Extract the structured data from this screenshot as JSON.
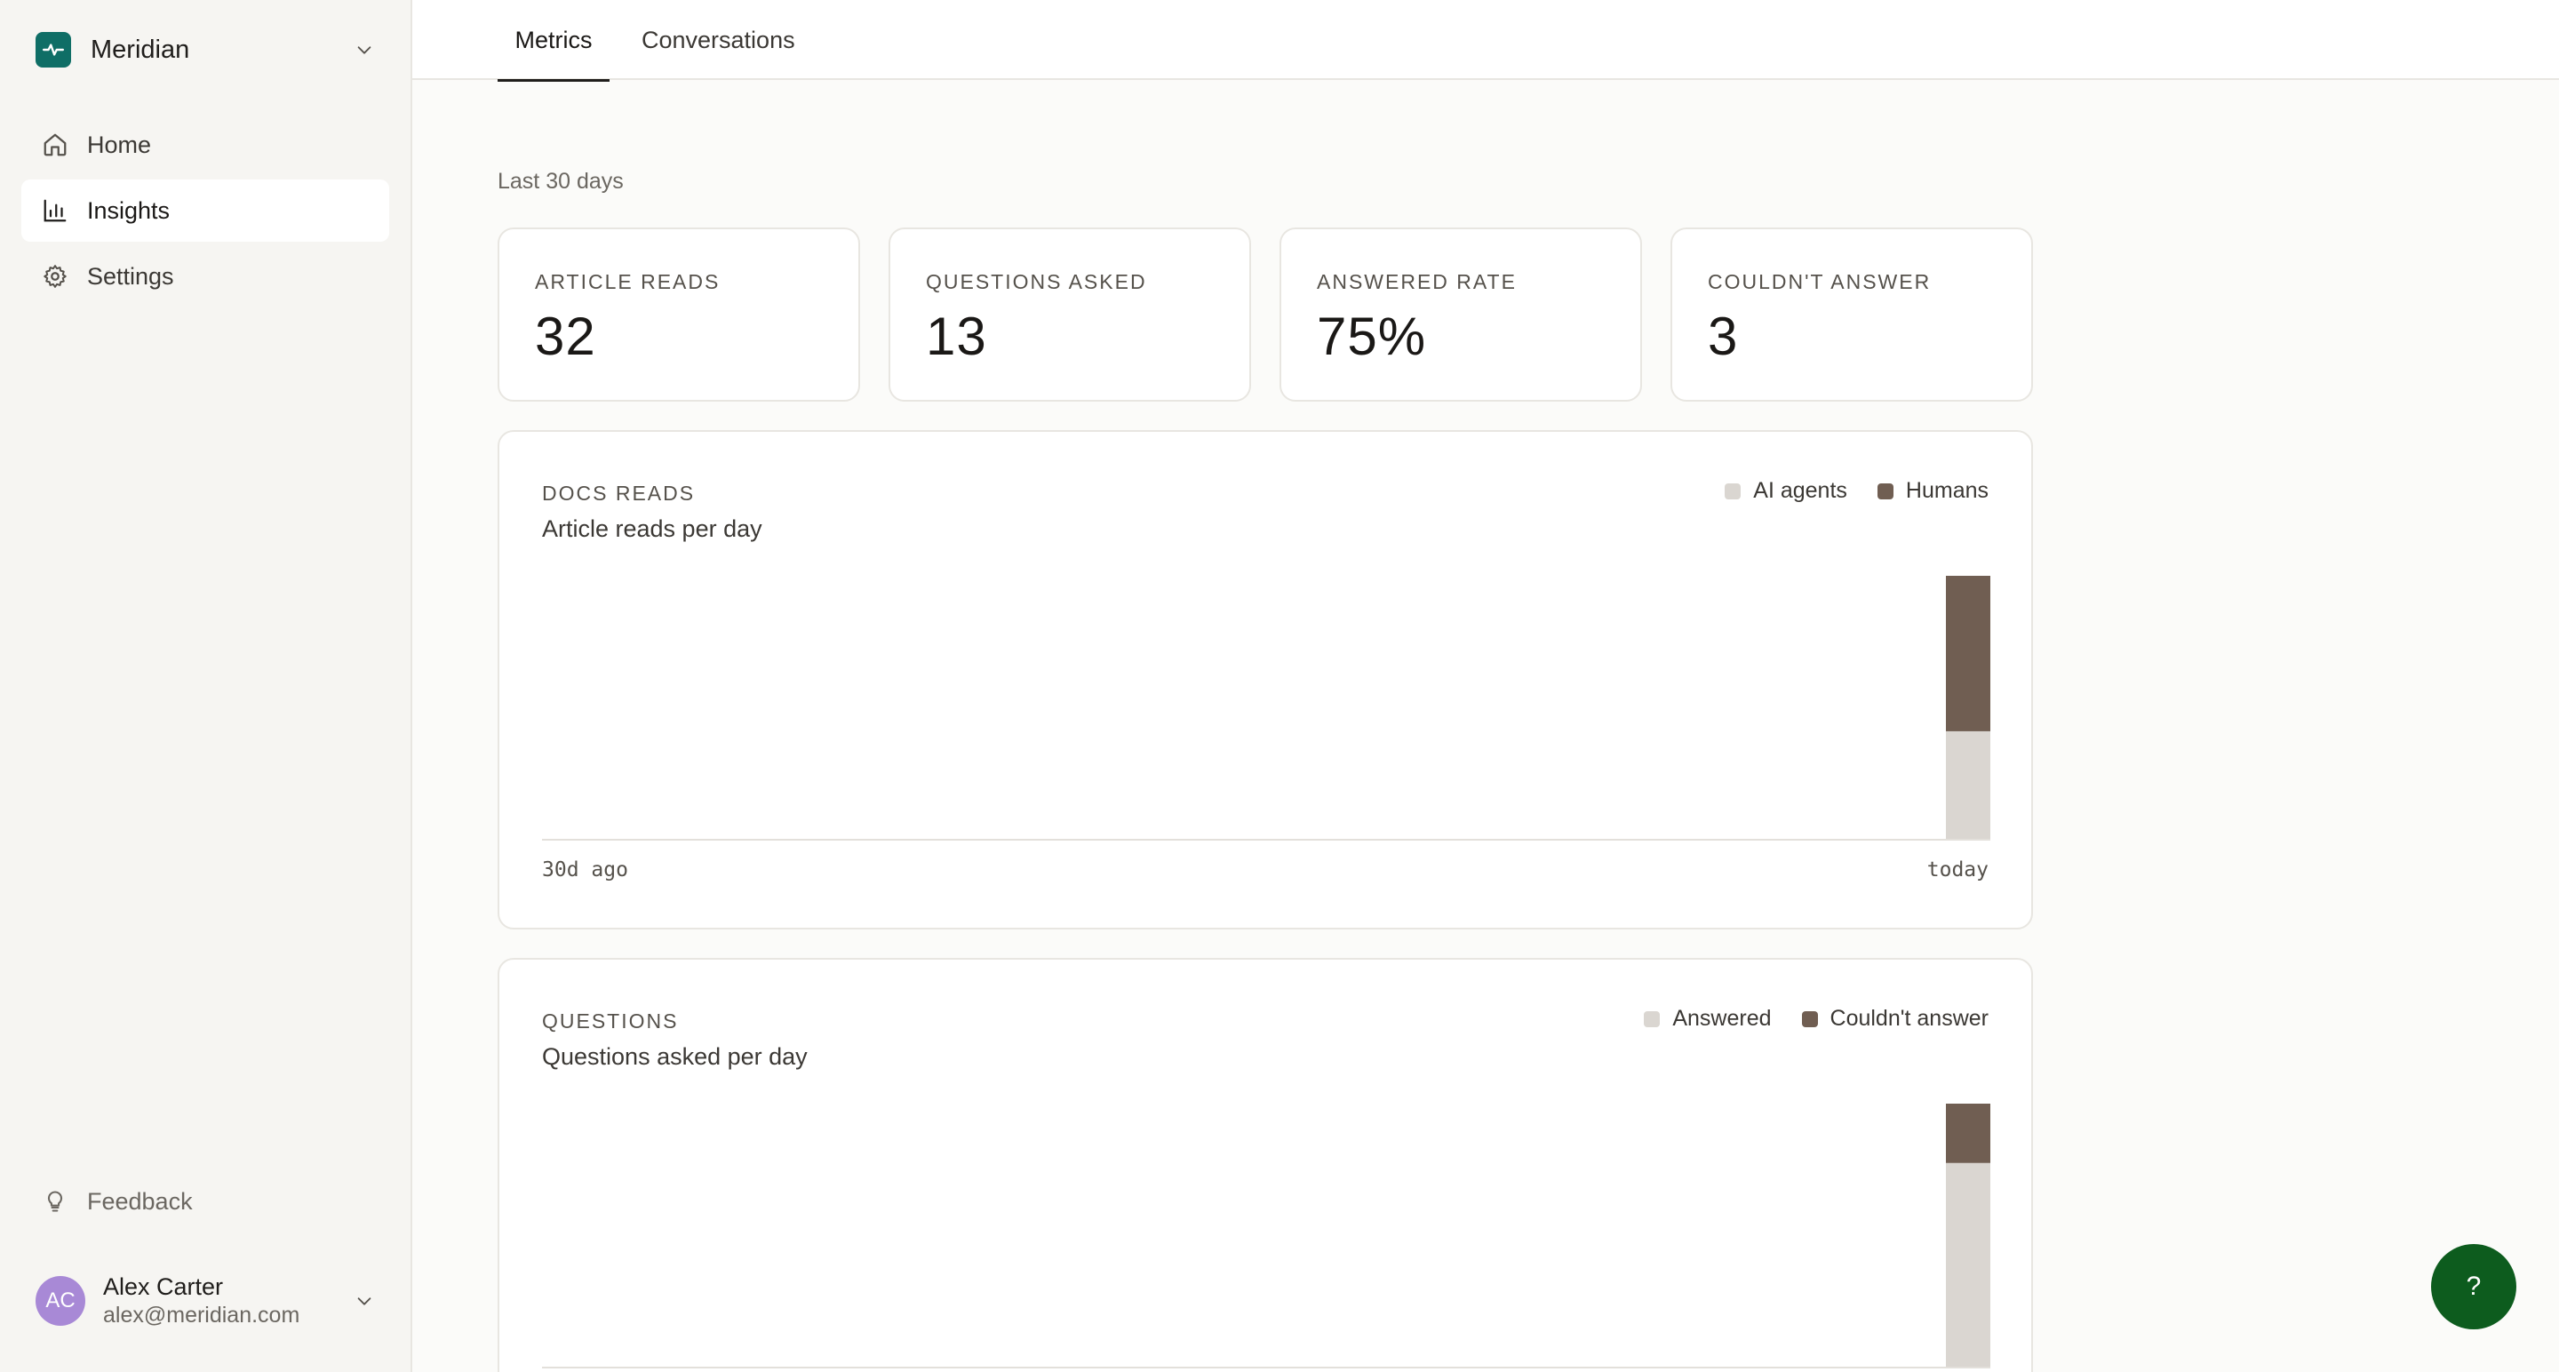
{
  "app": {
    "name": "Meridian",
    "logo_icon": "pulse-icon",
    "accent": "#0f6e66"
  },
  "sidebar": {
    "items": [
      {
        "label": "Home",
        "icon": "home-icon",
        "active": false
      },
      {
        "label": "Insights",
        "icon": "bar-chart-icon",
        "active": true
      },
      {
        "label": "Settings",
        "icon": "gear-icon",
        "active": false
      }
    ],
    "feedback_label": "Feedback"
  },
  "user": {
    "initials": "AC",
    "name": "Alex Carter",
    "email": "alex@meridian.com",
    "avatar_color": "#a889d6"
  },
  "tabs": [
    {
      "label": "Metrics",
      "active": true
    },
    {
      "label": "Conversations",
      "active": false
    }
  ],
  "range_label": "Last 30 days",
  "stats": [
    {
      "label": "ARTICLE READS",
      "value": "32"
    },
    {
      "label": "QUESTIONS ASKED",
      "value": "13"
    },
    {
      "label": "ANSWERED RATE",
      "value": "75%"
    },
    {
      "label": "COULDN'T ANSWER",
      "value": "3"
    }
  ],
  "help_label": "?",
  "chart_data": [
    {
      "type": "bar",
      "stacked": true,
      "kicker": "DOCS READS",
      "subtitle": "Article reads per day",
      "x_start_label": "30d ago",
      "x_end_label": "today",
      "days": 30,
      "series": [
        {
          "name": "AI agents",
          "color": "#dad6d1",
          "values": [
            0,
            0,
            0,
            0,
            0,
            0,
            0,
            0,
            0,
            0,
            0,
            0,
            0,
            0,
            0,
            0,
            0,
            0,
            0,
            0,
            0,
            0,
            0,
            0,
            0,
            0,
            0,
            0,
            0,
            13
          ]
        },
        {
          "name": "Humans",
          "color": "#705e52",
          "values": [
            0,
            0,
            0,
            0,
            0,
            0,
            0,
            0,
            0,
            0,
            0,
            0,
            0,
            0,
            0,
            0,
            0,
            0,
            0,
            0,
            0,
            0,
            0,
            0,
            0,
            0,
            0,
            0,
            0,
            19
          ]
        }
      ],
      "ylim": [
        0,
        32
      ]
    },
    {
      "type": "bar",
      "stacked": true,
      "kicker": "QUESTIONS",
      "subtitle": "Questions asked per day",
      "x_start_label": "30d ago",
      "x_end_label": "today",
      "days": 30,
      "series": [
        {
          "name": "Answered",
          "color": "#dad6d1",
          "values": [
            0,
            0,
            0,
            0,
            0,
            0,
            0,
            0,
            0,
            0,
            0,
            0,
            0,
            0,
            0,
            0,
            0,
            0,
            0,
            0,
            0,
            0,
            0,
            0,
            0,
            0,
            0,
            0,
            0,
            10
          ]
        },
        {
          "name": "Couldn't answer",
          "color": "#705e52",
          "values": [
            0,
            0,
            0,
            0,
            0,
            0,
            0,
            0,
            0,
            0,
            0,
            0,
            0,
            0,
            0,
            0,
            0,
            0,
            0,
            0,
            0,
            0,
            0,
            0,
            0,
            0,
            0,
            0,
            0,
            3
          ]
        }
      ],
      "ylim": [
        0,
        13
      ]
    }
  ]
}
